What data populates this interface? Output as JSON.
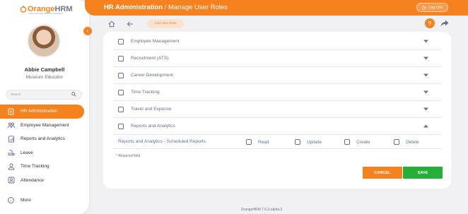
{
  "colors": {
    "accent": "#f5821f",
    "save": "#27ae39",
    "text_muted": "#64728c"
  },
  "brand": {
    "logo_orange": "Orange",
    "logo_grey": "HRM",
    "logo_sub": "OPEN SOURCE HR MANAGEMENT"
  },
  "user": {
    "name": "Abbie Campbell",
    "role": "Museum Educator"
  },
  "search": {
    "placeholder": "Search"
  },
  "sidebar": {
    "items": [
      {
        "label": "HR Administration",
        "icon": "hr-admin-icon",
        "active": true
      },
      {
        "label": "Employee Management",
        "icon": "employee-icon",
        "active": false
      },
      {
        "label": "Reports and Analytics",
        "icon": "reports-icon",
        "active": false
      },
      {
        "label": "Leave",
        "icon": "leave-icon",
        "active": false
      },
      {
        "label": "Time Tracking",
        "icon": "time-icon",
        "active": false
      },
      {
        "label": "Attendance",
        "icon": "attendance-icon",
        "active": false
      }
    ],
    "more_label": "More"
  },
  "topbar": {
    "section": "HR Administration",
    "separator": " / ",
    "page": "Manage User Roles",
    "logout": "Log Out"
  },
  "subbar": {
    "add_user_role": "Add User Role"
  },
  "permissions": {
    "rows": [
      {
        "label": "Employee Management",
        "expanded": false
      },
      {
        "label": "Recruitment (ATS)",
        "expanded": false
      },
      {
        "label": "Career Development",
        "expanded": false
      },
      {
        "label": "Time Tracking",
        "expanded": false
      },
      {
        "label": "Travel and Expense",
        "expanded": false
      },
      {
        "label": "Reports and Analytics",
        "expanded": true
      }
    ],
    "sub_row": {
      "label": "Reports and Analytics - Scheduled Reports",
      "options": [
        "Read",
        "Update",
        "Create",
        "Delete"
      ]
    }
  },
  "form": {
    "required_note": "* Required field",
    "cancel": "CANCEL",
    "save": "SAVE"
  },
  "footer": {
    "version": "OrangeHRM 7.6.2-alpha.2"
  }
}
